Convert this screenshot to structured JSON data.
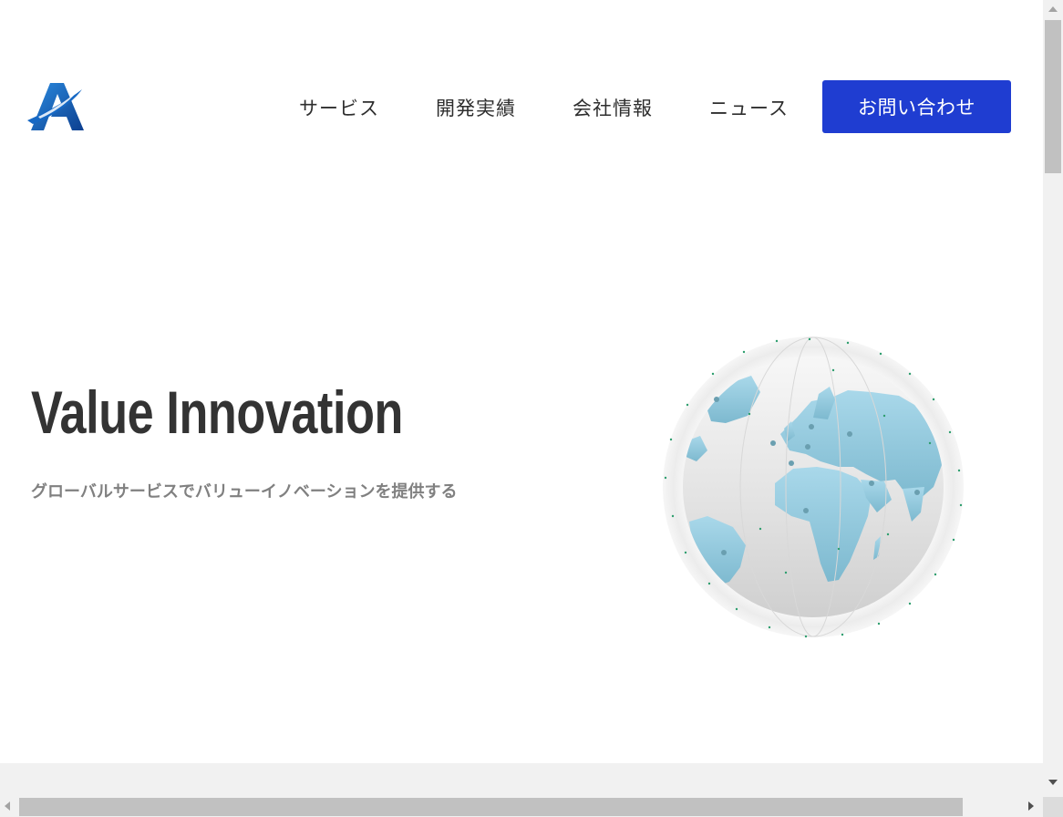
{
  "header": {
    "logo_icon": "company-a-logo-icon",
    "nav": {
      "services": "サービス",
      "works": "開発実績",
      "company": "会社情報",
      "news": "ニュース"
    },
    "contact_label": "お問い合わせ"
  },
  "hero": {
    "title": "Value Innovation",
    "subtitle": "グローバルサービスでバリューイノベーションを提供する",
    "image_icon": "globe-illustration-icon"
  },
  "colors": {
    "accent": "#1f3dd1",
    "title_text": "#333333",
    "subtitle_text": "#808080",
    "logo_blue": "#1a5fb4"
  },
  "scrollbars": {
    "vertical": "scrollbar",
    "horizontal": "scrollbar"
  }
}
